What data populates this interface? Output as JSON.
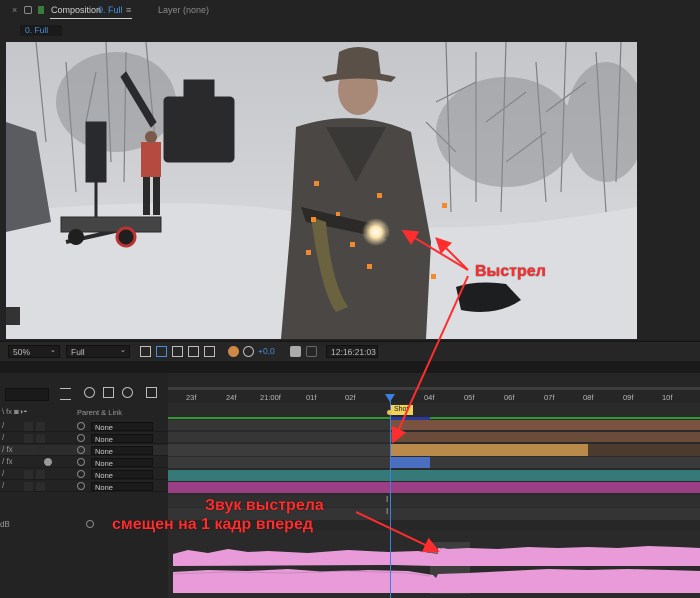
{
  "tabs": {
    "close": "×",
    "composition_label": "Composition",
    "composition_name": "0. Full",
    "layer_label": "Layer (none)"
  },
  "subbar": {
    "comp_tab": "0. Full"
  },
  "viewer_toolbar": {
    "zoom": "50%",
    "resolution": "Full",
    "exposure": "+0,0",
    "timecode": "12:16:21:03"
  },
  "timeline": {
    "ruler_labels": [
      "23f",
      "24f",
      "21:00f",
      "01f",
      "02f",
      "04f",
      "05f",
      "06f",
      "07f",
      "08f",
      "09f",
      "10f"
    ],
    "marker_label": "Shot",
    "column_header": "Parent & Link",
    "db_label": "dB",
    "parent_rows": [
      "None",
      "None",
      "None",
      "None",
      "None",
      "None"
    ]
  },
  "annotations": {
    "shot": "Выстрел",
    "sound_line1": "Звук выстрела",
    "sound_line2": "смещен на 1 кадр вперед"
  },
  "colors": {
    "accent_blue": "#4a8fd8",
    "annotation_red": "#ff2d2d",
    "audio_pink": "#e89bd8",
    "playhead": "#3a82e0"
  }
}
